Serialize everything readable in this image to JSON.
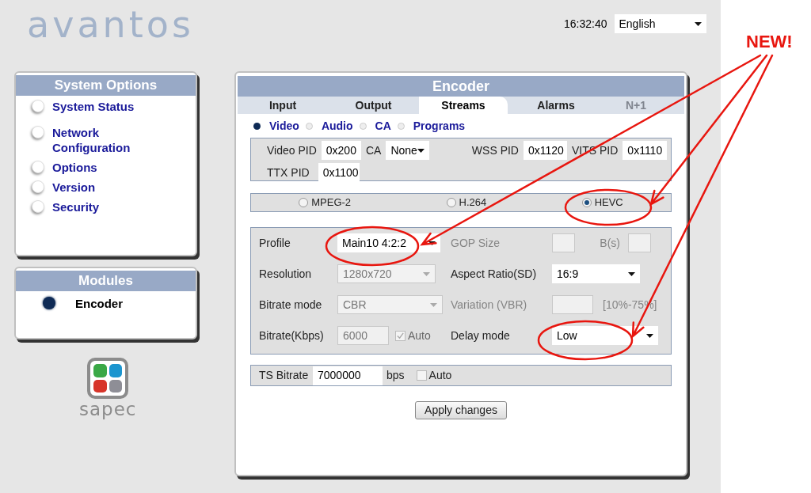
{
  "header": {
    "logo": "avantos",
    "time": "16:32:40",
    "language": "English"
  },
  "system_options": {
    "title": "System Options",
    "items": [
      {
        "label": "System Status",
        "selected": false
      },
      {
        "label": "Network Configuration",
        "selected": false
      },
      {
        "label": "Options",
        "selected": false
      },
      {
        "label": "Version",
        "selected": false
      },
      {
        "label": "Security",
        "selected": false
      }
    ]
  },
  "modules": {
    "title": "Modules",
    "items": [
      {
        "label": "Encoder",
        "selected": true
      }
    ]
  },
  "brand": "sapec",
  "encoder": {
    "title": "Encoder",
    "tabs": [
      {
        "label": "Input",
        "selected": false,
        "disabled": false
      },
      {
        "label": "Output",
        "selected": false,
        "disabled": false
      },
      {
        "label": "Streams",
        "selected": true,
        "disabled": false
      },
      {
        "label": "Alarms",
        "selected": false,
        "disabled": false
      },
      {
        "label": "N+1",
        "selected": false,
        "disabled": true
      }
    ],
    "stream_types": [
      {
        "label": "Video",
        "selected": true
      },
      {
        "label": "Audio",
        "selected": false
      },
      {
        "label": "CA",
        "selected": false
      },
      {
        "label": "Programs",
        "selected": false
      }
    ],
    "pid_rows": [
      [
        {
          "kind": "label",
          "text": "Video PID"
        },
        {
          "kind": "text",
          "value": "0x200"
        },
        {
          "kind": "label",
          "text": "CA"
        },
        {
          "kind": "select",
          "value": "None"
        },
        {
          "kind": "label",
          "text": "WSS PID"
        },
        {
          "kind": "text",
          "value": "0x1120"
        },
        {
          "kind": "label",
          "text": "VITS PID"
        },
        {
          "kind": "text",
          "value": "0x1110"
        }
      ],
      [
        {
          "kind": "label",
          "text": "TTX PID"
        },
        {
          "kind": "text",
          "value": "0x1100"
        }
      ]
    ],
    "codecs": [
      {
        "label": "MPEG-2",
        "selected": false
      },
      {
        "label": "H.264",
        "selected": false
      },
      {
        "label": "HEVC",
        "selected": true
      }
    ],
    "settings": [
      {
        "left": [
          {
            "kind": "label",
            "text": "Profile",
            "disabled": false
          },
          {
            "kind": "select",
            "value": "Main10 4:2:2",
            "disabled": false
          }
        ],
        "right": [
          {
            "kind": "label",
            "text": "GOP Size",
            "disabled": true
          },
          {
            "kind": "text",
            "disabled": true
          },
          {
            "kind": "label",
            "text": "B(s)",
            "disabled": true
          },
          {
            "kind": "text",
            "disabled": true
          }
        ]
      },
      {
        "left": [
          {
            "kind": "label",
            "text": "Resolution",
            "disabled": false
          },
          {
            "kind": "select",
            "value": "1280x720",
            "disabled": true
          }
        ],
        "right": [
          {
            "kind": "label",
            "text": "Aspect Ratio(SD)",
            "disabled": false
          },
          {
            "kind": "select",
            "value": "16:9",
            "disabled": false
          }
        ]
      },
      {
        "left": [
          {
            "kind": "label",
            "text": "Bitrate mode",
            "disabled": false
          },
          {
            "kind": "select",
            "value": "CBR",
            "disabled": true
          }
        ],
        "right": [
          {
            "kind": "label",
            "text": "Variation (VBR)",
            "disabled": true
          },
          {
            "kind": "text",
            "disabled": true
          },
          {
            "kind": "label",
            "text": "[10%-75%]",
            "disabled": true
          }
        ]
      },
      {
        "left": [
          {
            "kind": "label",
            "text": "Bitrate(Kbps)",
            "disabled": false
          },
          {
            "kind": "text",
            "value": "6000",
            "disabled": true
          },
          {
            "kind": "checkbox",
            "text": "Auto",
            "checked": true,
            "disabled": true
          }
        ],
        "right": [
          {
            "kind": "label",
            "text": "Delay mode",
            "disabled": false
          },
          {
            "kind": "select",
            "value": "Low",
            "disabled": false
          }
        ]
      }
    ],
    "ts_bitrate": {
      "label": "TS Bitrate",
      "value": "7000000",
      "unit": "bps",
      "auto": {
        "text": "Auto",
        "checked": false
      }
    },
    "apply_button": "Apply changes"
  },
  "annotation": {
    "text": "NEW!"
  }
}
